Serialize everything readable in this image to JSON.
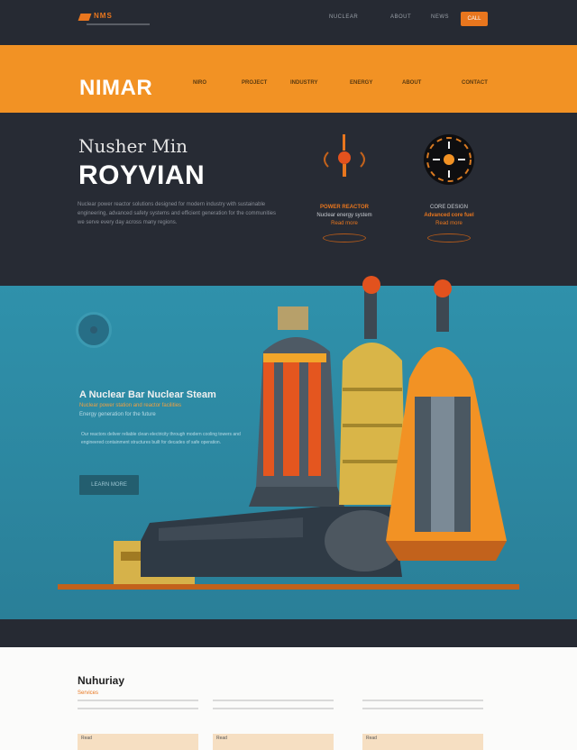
{
  "topbar": {
    "logo_text": "NMS",
    "links": [
      "NUCLEAR",
      "ABOUT",
      "NEWS"
    ],
    "cta_label": "CALL"
  },
  "band": {
    "brand": "NIMAR",
    "nav": [
      "NIRO",
      "PROJECT",
      "INDUSTRY",
      "ENERGY",
      "ABOUT",
      "CONTACT"
    ]
  },
  "hero": {
    "eyebrow": "Nusher Min",
    "title": "ROYVIAN",
    "paragraph": "Nuclear power reactor solutions designed for modern industry with sustainable engineering, advanced safety systems and efficient generation for the communities we serve every day across many regions.",
    "features": [
      {
        "t1": "POWER REACTOR",
        "t2": "Nuclear energy system",
        "t3": "Read more"
      },
      {
        "t1": "CORE DESIGN",
        "t2": "Advanced core fuel",
        "t3": "Read more"
      }
    ]
  },
  "teal": {
    "title": "A Nuclear Bar Nuclear Steam",
    "subtitle": "Nuclear power station and reactor facilities",
    "subtitle2": "Energy generation for the future",
    "paragraph": "Our reactors deliver reliable clean electricity through modern cooling towers and engineered containment structures built for decades of safe operation.",
    "button": "LEARN MORE"
  },
  "section": {
    "title": "Nuhuriay",
    "subtitle": "Services",
    "cards": [
      {
        "tag": "Read"
      },
      {
        "tag": "Read"
      },
      {
        "tag": "Read"
      }
    ]
  },
  "colors": {
    "accent": "#f29224",
    "dark": "#272b34",
    "teal": "#2f91ab"
  }
}
